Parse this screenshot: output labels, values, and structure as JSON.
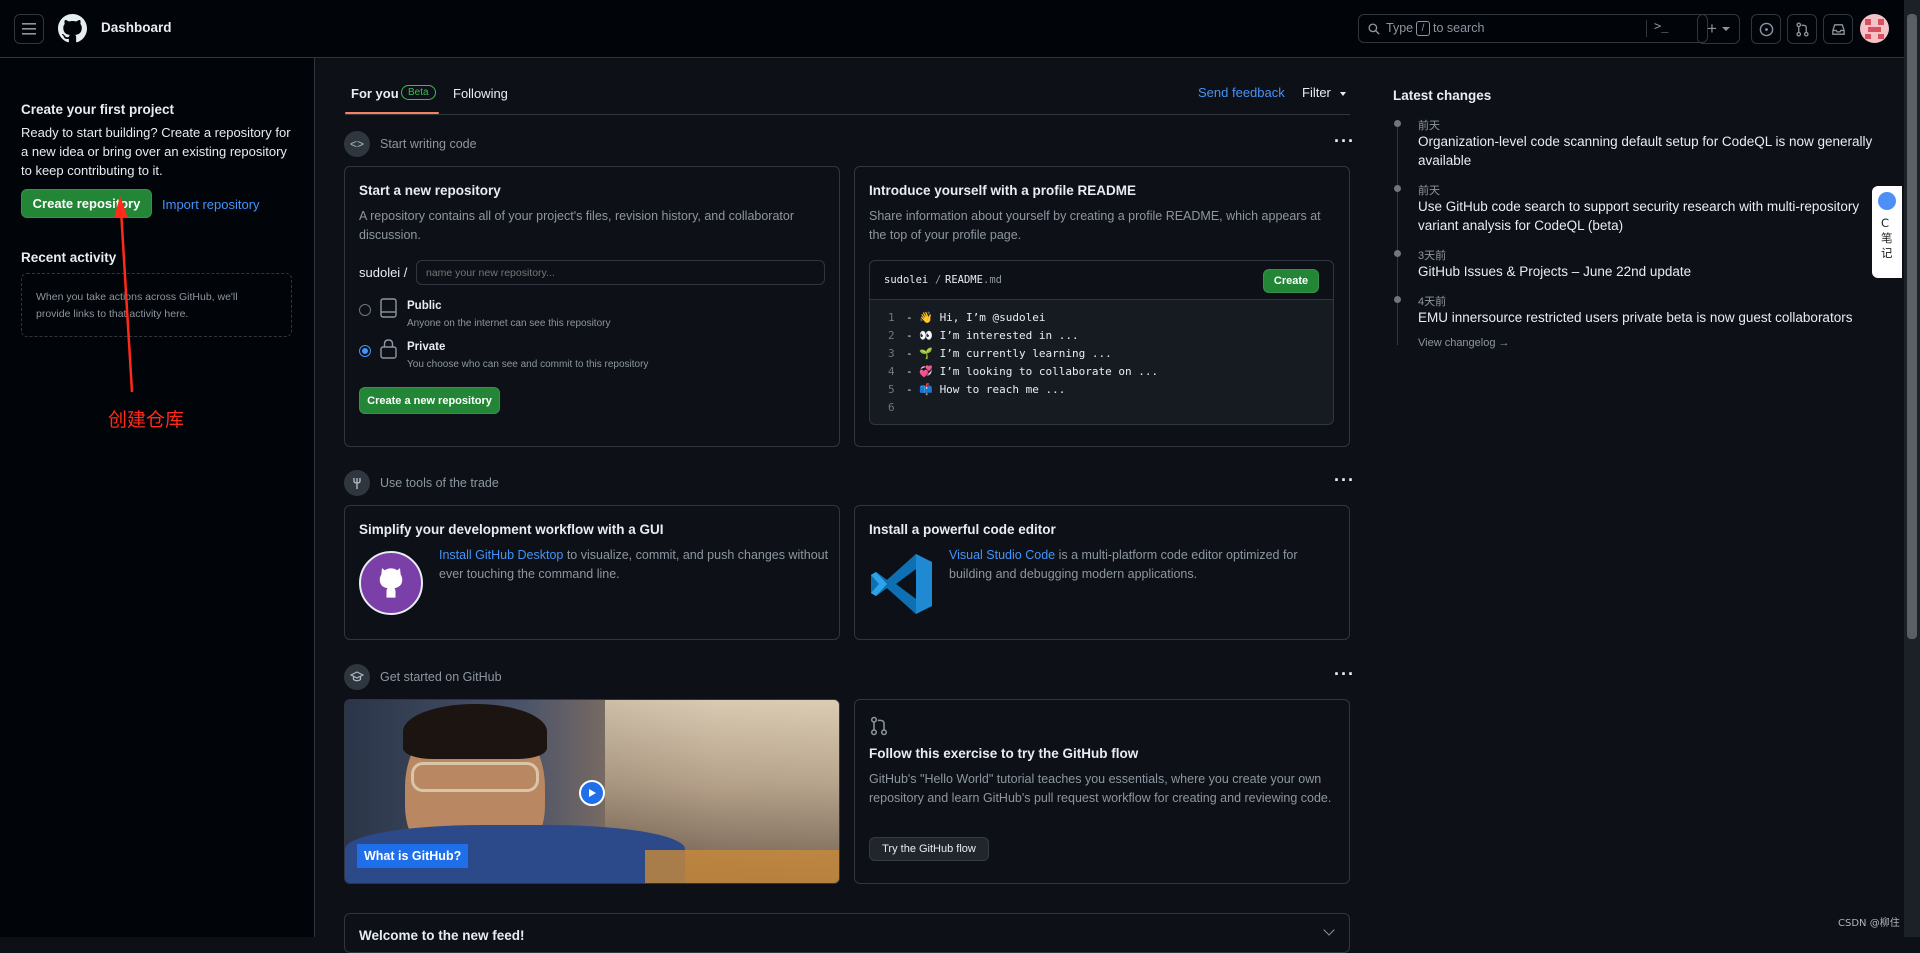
{
  "header": {
    "title": "Dashboard",
    "search_placeholder_prefix": "Type",
    "search_key": "/",
    "search_placeholder_suffix": "to search",
    "plus_label": "+"
  },
  "sidebar": {
    "heading": "Create your first project",
    "description": "Ready to start building? Create a repository for a new idea or bring over an existing repository to keep contributing to it.",
    "create_button": "Create repository",
    "import_link": "Import repository",
    "recent_heading": "Recent activity",
    "recent_empty": "When you take actions across GitHub, we'll provide links to that activity here.",
    "annotation": "创建仓库"
  },
  "feed": {
    "tabs": [
      {
        "label": "For you",
        "badge": "Beta"
      },
      {
        "label": "Following"
      }
    ],
    "send_feedback": "Send feedback",
    "filter": "Filter",
    "sections": {
      "start_writing": "Start writing code",
      "use_tools": "Use tools of the trade",
      "get_started": "Get started on GitHub"
    },
    "new_repo": {
      "title": "Start a new repository",
      "description": "A repository contains all of your project's files, revision history, and collaborator discussion.",
      "owner": "sudolei /",
      "name_placeholder": "name your new repository...",
      "public_label": "Public",
      "public_desc": "Anyone on the internet can see this repository",
      "private_label": "Private",
      "private_desc": "You choose who can see and commit to this repository",
      "button": "Create a new repository"
    },
    "readme": {
      "title": "Introduce yourself with a profile README",
      "description": "Share information about yourself by creating a profile README, which appears at the top of your profile page.",
      "path_user": "sudolei",
      "path_sep": "/",
      "path_file": "README",
      "path_ext": ".md",
      "create_button": "Create",
      "lines": [
        {
          "n": "1",
          "text": "- 👋 Hi, I’m @sudolei"
        },
        {
          "n": "2",
          "text": "- 👀 I’m interested in ..."
        },
        {
          "n": "3",
          "text": "- 🌱 I’m currently learning ..."
        },
        {
          "n": "4",
          "text": "- 💞️ I’m looking to collaborate on ..."
        },
        {
          "n": "5",
          "text": "- 📫 How to reach me ..."
        },
        {
          "n": "6",
          "text": ""
        }
      ]
    },
    "desktop": {
      "title": "Simplify your development workflow with a GUI",
      "link": "Install GitHub Desktop",
      "text": " to visualize, commit, and push changes without ever touching the command line."
    },
    "editor": {
      "title": "Install a powerful code editor",
      "link": "Visual Studio Code",
      "text": " is a multi-platform code editor optimized for building and debugging modern applications."
    },
    "video": {
      "caption": "What is GitHub?"
    },
    "flow": {
      "title": "Follow this exercise to try the GitHub flow",
      "description": "GitHub's \"Hello World\" tutorial teaches you essentials, where you create your own repository and learn GitHub's pull request workflow for creating and reviewing code.",
      "button": "Try the GitHub flow"
    },
    "welcome": "Welcome to the new feed!"
  },
  "changes": {
    "heading": "Latest changes",
    "items": [
      {
        "date": "前天",
        "text": "Organization-level code scanning default setup for CodeQL is now generally available"
      },
      {
        "date": "前天",
        "text": "Use GitHub code search to support security research with multi-repository variant analysis for CodeQL (beta)"
      },
      {
        "date": "3天前",
        "text": "GitHub Issues & Projects – June 22nd update"
      },
      {
        "date": "4天前",
        "text": "EMU innersource restricted users private beta is now guest collaborators"
      }
    ],
    "view_changelog": "View changelog →"
  },
  "overlay": {
    "side_widget": "C笔记",
    "watermark": "CSDN @柳住"
  },
  "colors": {
    "bg": "#0d1117",
    "header_bg": "#010409",
    "border": "#30363d",
    "green": "#238636",
    "link": "#4493f8",
    "annotation": "#ff2a1a"
  }
}
